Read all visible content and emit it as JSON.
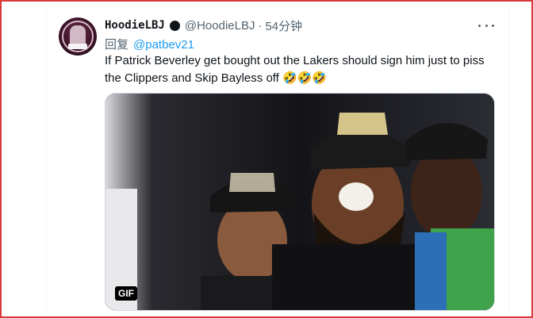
{
  "tweet": {
    "display_name": "HoodieLBJ",
    "handle": "@HoodieLBJ",
    "separator": "·",
    "time": "54分钟",
    "reply_prefix": "回复",
    "reply_mention": "@patbev21",
    "text": "If Patrick Beverley get bought out the Lakers should sign him just to piss the Clippers and Skip Bayless off 🤣🤣🤣",
    "media_badge": "GIF"
  },
  "icons": {
    "avatar": "profile-avatar",
    "verified": "verified-badge-icon",
    "more": "more-options-icon"
  },
  "colors": {
    "frame_border": "#d93a3a",
    "mention": "#1d9bf0",
    "muted_text": "#536471",
    "primary_text": "#0f1419"
  }
}
